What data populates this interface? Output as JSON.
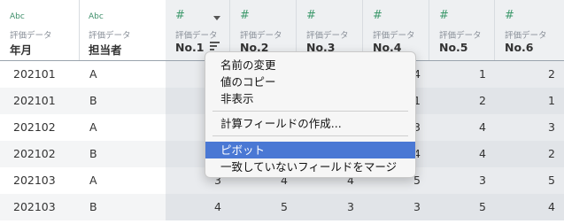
{
  "columns": [
    {
      "type_icon": "Abc",
      "source": "評価データ",
      "name": "年月"
    },
    {
      "type_icon": "Abc",
      "source": "評価データ",
      "name": "担当者"
    },
    {
      "type_icon": "#",
      "source": "評価データ",
      "name": "No.1"
    },
    {
      "type_icon": "#",
      "source": "評価データ",
      "name": "No.2"
    },
    {
      "type_icon": "#",
      "source": "評価データ",
      "name": "No.3"
    },
    {
      "type_icon": "#",
      "source": "評価データ",
      "name": "No.4"
    },
    {
      "type_icon": "#",
      "source": "評価データ",
      "name": "No.5"
    },
    {
      "type_icon": "#",
      "source": "評価データ",
      "name": "No.6"
    }
  ],
  "rows": [
    {
      "c0": "202101",
      "c1": "A",
      "c2": "",
      "c3": "",
      "c4": "",
      "c5": "4",
      "c6": "1",
      "c7": "2"
    },
    {
      "c0": "202101",
      "c1": "B",
      "c2": "",
      "c3": "",
      "c4": "",
      "c5": "1",
      "c6": "2",
      "c7": "1"
    },
    {
      "c0": "202102",
      "c1": "A",
      "c2": "",
      "c3": "",
      "c4": "",
      "c5": "3",
      "c6": "4",
      "c7": "3"
    },
    {
      "c0": "202102",
      "c1": "B",
      "c2": "",
      "c3": "",
      "c4": "",
      "c5": "4",
      "c6": "4",
      "c7": "2"
    },
    {
      "c0": "202103",
      "c1": "A",
      "c2": "3",
      "c3": "4",
      "c4": "4",
      "c5": "5",
      "c6": "3",
      "c7": "5"
    },
    {
      "c0": "202103",
      "c1": "B",
      "c2": "4",
      "c3": "5",
      "c4": "3",
      "c5": "3",
      "c6": "5",
      "c7": "4"
    }
  ],
  "context_menu": {
    "rename": "名前の変更",
    "copy_values": "値のコピー",
    "hide": "非表示",
    "create_calc": "計算フィールドの作成...",
    "pivot": "ピボット",
    "merge": "一致していないフィールドをマージ"
  },
  "colors": {
    "menu_highlight": "#4a78d4",
    "type_icon": "#3f8f6b"
  }
}
